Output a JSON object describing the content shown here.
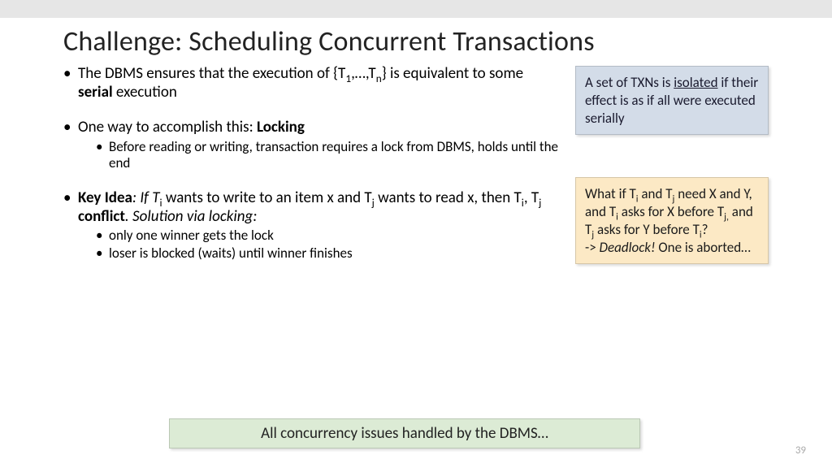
{
  "title": "Challenge: Scheduling Concurrent Transactions",
  "bullets": {
    "b1_pre": "The DBMS ensures that the execution of {T",
    "b1_mid": ",…,T",
    "b1_post": "} is equivalent to some ",
    "b1_bold": "serial",
    "b1_end": " execution",
    "b2_pre": "One way to accomplish this: ",
    "b2_bold": "Locking",
    "b2_sub1": "Before reading or writing, transaction requires a lock from DBMS, holds until the end",
    "b3_bold1": "Key Idea",
    "b3_mid1": ": If T",
    "b3_mid2": " wants to write to an item x and T",
    "b3_mid3": " wants to read x, then T",
    "b3_mid4": ", T",
    "b3_bold2": "conflict",
    "b3_end": ".  Solution via locking:",
    "b3_sub1": "only one winner gets the lock",
    "b3_sub2": "loser is blocked (waits) until winner finishes"
  },
  "sub": {
    "one": "1",
    "n": "n",
    "i": "i",
    "j": "j"
  },
  "callout_blue": {
    "pre": "A set of TXNs is ",
    "u": "isolated",
    "post": " if their effect is as if all were executed serially"
  },
  "callout_yellow": {
    "l1a": "What if T",
    "l1b": " and T",
    "l1c": " need X and Y, and T",
    "l1d": " asks for X before T",
    "l1e": " and T",
    "l1f": " asks for Y before T",
    "l1g": "?",
    "l2a": "-> ",
    "l2b": "Deadlock!",
    "l2c": "  One is aborted…"
  },
  "footer": "All concurrency issues handled by the DBMS…",
  "page": "39"
}
